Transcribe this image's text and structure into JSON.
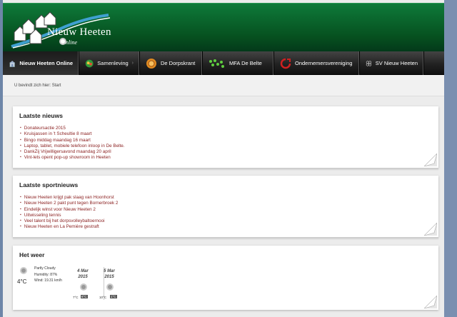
{
  "site": {
    "title": "Nieuw Heeten",
    "subtitle": "nline"
  },
  "nav": {
    "items": [
      {
        "label": "Nieuw Heeten Online",
        "icon": "home-icon"
      },
      {
        "label": "Samenleving",
        "icon": "community-icon",
        "arrow": "›"
      },
      {
        "label": "De Dorpskrant",
        "icon": "newspaper-icon"
      },
      {
        "label": "MFA De Belte",
        "icon": "building-icon"
      },
      {
        "label": "Ondernemersvereniging",
        "icon": "business-icon"
      },
      {
        "label": "SV Nieuw Heeten",
        "icon": "football-icon"
      }
    ]
  },
  "breadcrumb": {
    "text": "U bevindt zich hier:  Start"
  },
  "news": {
    "title": "Laatste nieuws",
    "items": [
      "Donateursactie 2015",
      "Kruisjassen in 't Scheultie 8 maart",
      "Bingo middag maandag 16 maart",
      "Laptop, tablet, mobiele telefoon inloop in De Belte.",
      "DankZij Vrijwilligersavond maandag 20 april",
      "Vint-lets opent pop-up showroom in Heeten"
    ]
  },
  "sports": {
    "title": "Laatste sportnieuws",
    "items": [
      "Nieuw Heeten krijgt pak slaag van Hoonhorst",
      "Nieuw Heeten 2 pakt punt tegen Bornerbroek 2",
      "Eindelijk winst voor Nieuw Heeten 2",
      "Uitwisseling tennis",
      "Veel talent bij het dorpsvolleybaltoernooi",
      "Nieuw Heeten en La Pemière gestraft"
    ]
  },
  "weather": {
    "title": "Het weer",
    "current": {
      "temp": "4°C",
      "condition": "Partly Cloudy",
      "humidity": "Humidity: 87%",
      "wind": "Wind: 19.31 km/h"
    },
    "forecast": [
      {
        "day": "4 Mar",
        "year": "2015",
        "low": "7°C",
        "high": "6°C"
      },
      {
        "day": "5 Mar",
        "year": "2015",
        "low": "10°C",
        "high": "1°C"
      }
    ]
  },
  "colors": {
    "header_green": "#0e7a3a",
    "link_red": "#8a1f1f",
    "nav_dark": "#222222"
  }
}
